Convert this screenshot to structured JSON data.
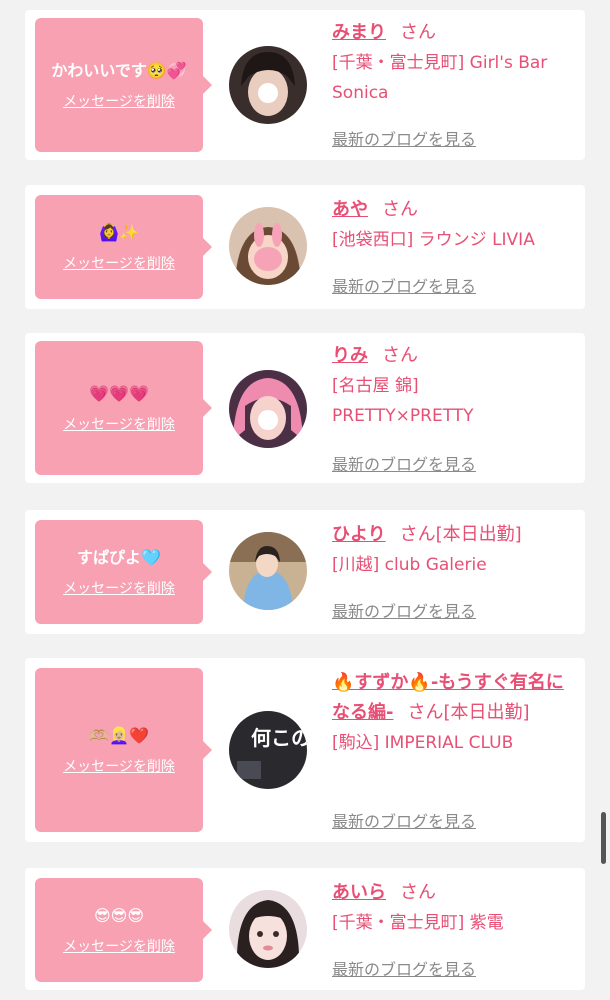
{
  "delete_label": "メッセージを削除",
  "blog_label": "最新のブログを見る",
  "san_label": "さん",
  "accent_color": "#e84f75",
  "bubble_color": "#f7a1b3",
  "cards": [
    {
      "message": "かわいいです🥺💞",
      "name": "みまり",
      "extra": "",
      "shop": "[千葉・富士見町] Girl's Bar Sonica",
      "avatar_icon": "avatar-photo"
    },
    {
      "message": "🙆‍♀️✨",
      "name": "あや",
      "extra": "",
      "shop": "[池袋西口] ラウンジ LIVIA",
      "avatar_icon": "avatar-photo"
    },
    {
      "message": "💗💗💗",
      "name": "りみ",
      "extra": "",
      "shop": "[名古屋 錦] PRETTY×PRETTY",
      "avatar_icon": "avatar-photo"
    },
    {
      "message": "すぱぴよ🩵",
      "name": "ひより",
      "extra": "[本日出勤]",
      "shop": "[川越] club Galerie",
      "avatar_icon": "avatar-photo"
    },
    {
      "message": "🫶🏼👱🏼‍♀️❤️",
      "name": "🔥すずか🔥-もうすぐ有名になる編-",
      "extra": "[本日出勤]",
      "shop": "[駒込] IMPERIAL CLUB",
      "avatar_icon": "avatar-placeholder",
      "avatar_text": "何この子?"
    },
    {
      "message": "😎😎😎",
      "name": "あいら",
      "extra": "",
      "shop": "[千葉・富士見町] 紫電",
      "avatar_icon": "avatar-photo"
    }
  ]
}
